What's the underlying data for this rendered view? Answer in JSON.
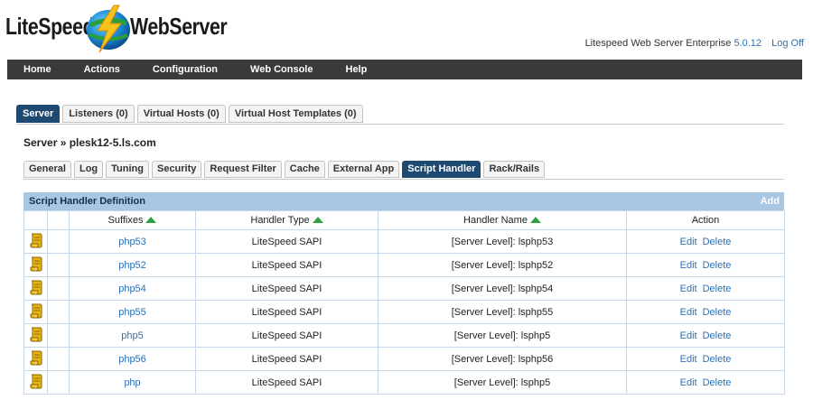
{
  "header": {
    "logo_left": "LiteSpeed",
    "logo_right": "WebServer",
    "product": "Litespeed Web Server Enterprise",
    "version": "5.0.12",
    "logoff": "Log Off"
  },
  "navbar": {
    "items": [
      "Home",
      "Actions",
      "Configuration",
      "Web Console",
      "Help"
    ]
  },
  "tabs_main": {
    "items": [
      {
        "label": "Server",
        "active": true
      },
      {
        "label": "Listeners (0)",
        "active": false
      },
      {
        "label": "Virtual Hosts (0)",
        "active": false
      },
      {
        "label": "Virtual Host Templates (0)",
        "active": false
      }
    ]
  },
  "breadcrumb": "Server » plesk12-5.ls.com",
  "tabs_server": {
    "items": [
      {
        "label": "General",
        "active": false
      },
      {
        "label": "Log",
        "active": false
      },
      {
        "label": "Tuning",
        "active": false
      },
      {
        "label": "Security",
        "active": false
      },
      {
        "label": "Request Filter",
        "active": false
      },
      {
        "label": "Cache",
        "active": false
      },
      {
        "label": "External App",
        "active": false
      },
      {
        "label": "Script Handler",
        "active": true
      },
      {
        "label": "Rack/Rails",
        "active": false
      }
    ]
  },
  "table": {
    "title": "Script Handler Definition",
    "add_label": "Add",
    "columns": [
      "Suffixes",
      "Handler Type",
      "Handler Name",
      "Action"
    ],
    "edit_label": "Edit",
    "delete_label": "Delete",
    "rows": [
      {
        "suffix": "php53",
        "type": "LiteSpeed SAPI",
        "name": "[Server Level]: lsphp53"
      },
      {
        "suffix": "php52",
        "type": "LiteSpeed SAPI",
        "name": "[Server Level]: lsphp52"
      },
      {
        "suffix": "php54",
        "type": "LiteSpeed SAPI",
        "name": "[Server Level]: lsphp54"
      },
      {
        "suffix": "php55",
        "type": "LiteSpeed SAPI",
        "name": "[Server Level]: lsphp55"
      },
      {
        "suffix": "php5",
        "type": "LiteSpeed SAPI",
        "name": "[Server Level]: lsphp5"
      },
      {
        "suffix": "php56",
        "type": "LiteSpeed SAPI",
        "name": "[Server Level]: lsphp56"
      },
      {
        "suffix": "php",
        "type": "LiteSpeed SAPI",
        "name": "[Server Level]: lsphp5"
      }
    ]
  },
  "colors": {
    "navbar": "#3a3a3a",
    "active_tab": "#1e4a72",
    "table_header": "#a9c6e3",
    "link": "#2d6fb3",
    "sort_arrow": "#2ea043"
  },
  "icons": {
    "row": "script-handler-icon",
    "sort": "sort-up-arrow-icon"
  }
}
